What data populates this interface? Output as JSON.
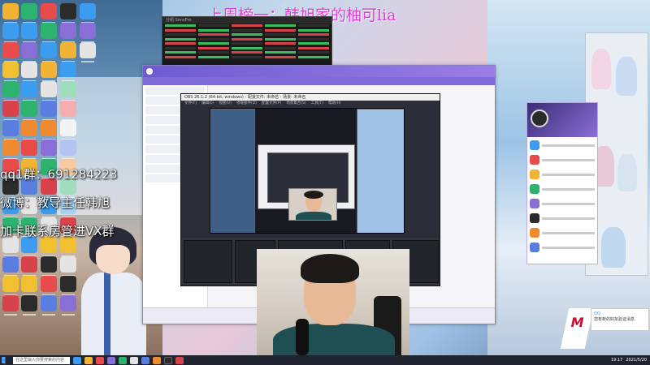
{
  "banner": {
    "text": "上周榜一：韩旭家的柚可lia"
  },
  "overlay": {
    "qq_group": "qq1群：691284223",
    "weibo": "微博：教导主任韩旭",
    "vx": "加卡联系房管进VX群"
  },
  "stock_window": {
    "title": "分组 SensPro"
  },
  "obs": {
    "title": "OBS 26.1.2 (64-bit, windows) - 配置文件: 未命名 - 场景: 未命名",
    "menu": [
      "文件(F)",
      "编辑(E)",
      "视图(V)",
      "停靠部件(D)",
      "配置文件(P)",
      "场景集合(S)",
      "工具(T)",
      "帮助(H)"
    ]
  },
  "notification": {
    "title": "QQ",
    "body": "您有新的好友验证消息"
  },
  "taskbar": {
    "search_placeholder": "在这里输入你要搜索的内容",
    "time": "19:17",
    "date": "2021/5/20"
  },
  "colors": {
    "banner": "#e23ad6",
    "qq_accent": "#7e6ad8",
    "obs_bg": "#2b2e38",
    "taskbar": "#1f2430"
  }
}
